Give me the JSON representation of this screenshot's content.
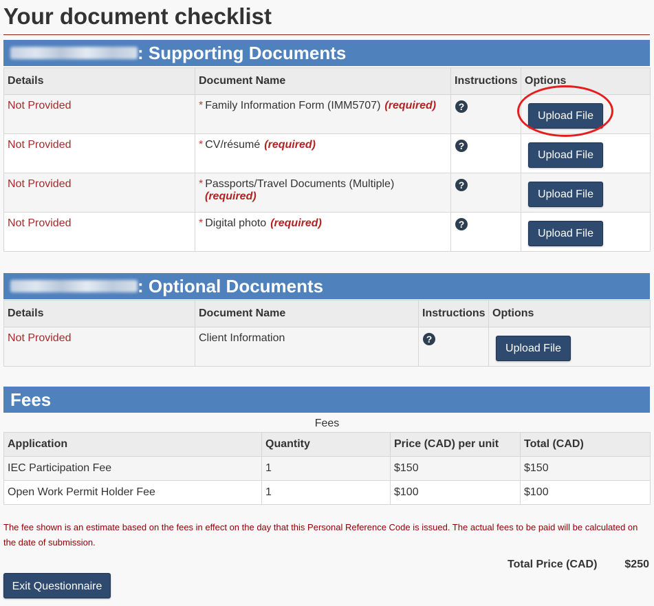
{
  "page": {
    "title": "Your document checklist"
  },
  "supporting": {
    "header_suffix": ": Supporting Documents",
    "columns": {
      "details": "Details",
      "document_name": "Document Name",
      "instructions": "Instructions",
      "options": "Options"
    },
    "rows": [
      {
        "status": "Not Provided",
        "name": "Family Information Form (IMM5707)",
        "required": "(required)",
        "upload": "Upload File"
      },
      {
        "status": "Not Provided",
        "name": "CV/résumé",
        "required": "(required)",
        "upload": "Upload File"
      },
      {
        "status": "Not Provided",
        "name": "Passports/Travel Documents (Multiple)",
        "required": "(required)",
        "upload": "Upload File"
      },
      {
        "status": "Not Provided",
        "name": "Digital photo",
        "required": "(required)",
        "upload": "Upload File"
      }
    ]
  },
  "optional": {
    "header_suffix": ": Optional Documents",
    "columns": {
      "details": "Details",
      "document_name": "Document Name",
      "instructions": "Instructions",
      "options": "Options"
    },
    "rows": [
      {
        "status": "Not Provided",
        "name": "Client Information",
        "upload": "Upload File"
      }
    ]
  },
  "fees": {
    "header": "Fees",
    "caption": "Fees",
    "columns": {
      "application": "Application",
      "quantity": "Quantity",
      "price": "Price (CAD) per unit",
      "total": "Total (CAD)"
    },
    "rows": [
      {
        "application": "IEC Participation Fee",
        "quantity": "1",
        "price": "$150",
        "total": "$150"
      },
      {
        "application": "Open Work Permit Holder Fee",
        "quantity": "1",
        "price": "$100",
        "total": "$100"
      }
    ],
    "note": "The fee shown is an estimate based on the fees in effect on the day that this Personal Reference Code is issued. The actual fees to be paid will be calculated on the date of submission.",
    "total_label": "Total Price (CAD)",
    "total_value": "$250"
  },
  "actions": {
    "exit": "Exit Questionnaire"
  },
  "icons": {
    "required_star": "*",
    "help": "?"
  },
  "colors": {
    "header_blue": "#4f81bd",
    "button_navy": "#2e4a6e",
    "status_red": "#a52a2a",
    "annotation_red": "#e41e1e"
  }
}
